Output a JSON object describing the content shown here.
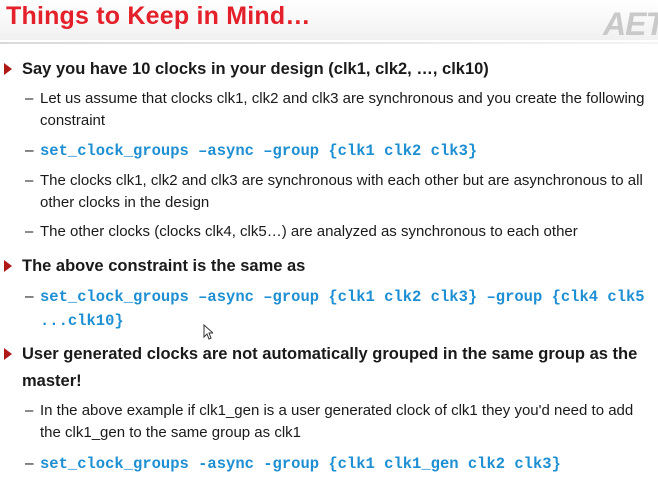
{
  "slide": {
    "title": "Things to Keep in Mind…",
    "logo": "AET",
    "bullets": [
      {
        "text": "Say you have 10 clocks in your design (clk1, clk2, …, clk10)",
        "sub": [
          "Let us assume that clocks clk1, clk2 and clk3 are synchronous and you create the following constraint",
          "set_clock_groups –async –group {clk1 clk2 clk3}",
          "The clocks clk1, clk2 and clk3 are synchronous with each other but are asynchronous to all other clocks in the design",
          "The other clocks (clocks clk4, clk5…) are analyzed as synchronous to each other"
        ]
      },
      {
        "text": "The above constraint is the same as",
        "sub": [
          "set_clock_groups –async –group {clk1 clk2 clk3} –group {clk4 clk5 ...clk10}"
        ]
      },
      {
        "text": "User generated clocks are not automatically grouped in the same group as the master!",
        "sub": [
          "In the above example if clk1_gen is a user generated clock of clk1 they you'd need to add the clk1_gen to the same group as clk1",
          "set_clock_groups -async -group {clk1 clk1_gen clk2 clk3}"
        ]
      }
    ]
  },
  "colors": {
    "title": "#e4202a",
    "bullet": "#b01818",
    "code": "#1e8fd2"
  }
}
